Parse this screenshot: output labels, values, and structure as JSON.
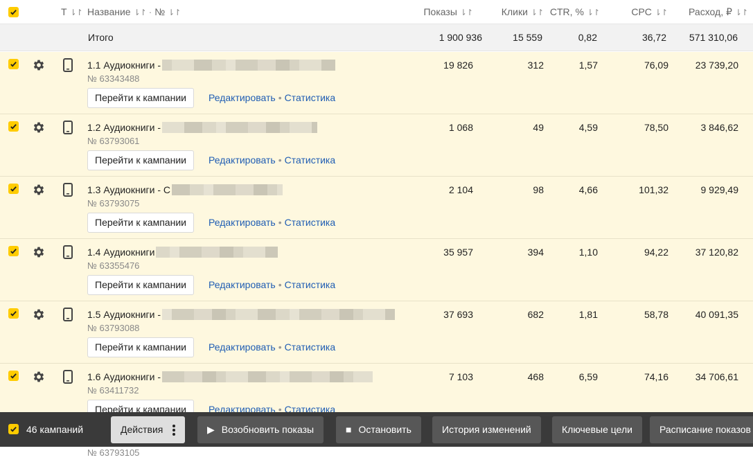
{
  "header": {
    "col_type": "Т",
    "col_name": "Название",
    "col_sep": "·",
    "col_number": "№",
    "col_shows": "Показы",
    "col_clicks": "Клики",
    "col_ctr": "CTR, %",
    "col_cpc": "CPC",
    "col_cost": "Расход, ₽",
    "sort_icon": "⇂↾"
  },
  "total": {
    "label": "Итого",
    "shows": "1 900 936",
    "clicks": "15 559",
    "ctr": "0,82",
    "cpc": "36,72",
    "cost": "571 310,06"
  },
  "row_actions": {
    "goto_label": "Перейти к кампании",
    "edit_label": "Редактировать",
    "dot": "•",
    "stats_label": "Статистика"
  },
  "rows": [
    {
      "name": "1.1 Аудиокниги -",
      "number": "№ 63343488",
      "shows": "19 826",
      "clicks": "312",
      "ctr": "1,57",
      "cpc": "76,09",
      "cost": "23 739,20"
    },
    {
      "name": "1.2 Аудиокниги -",
      "number": "№ 63793061",
      "shows": "1 068",
      "clicks": "49",
      "ctr": "4,59",
      "cpc": "78,50",
      "cost": "3 846,62"
    },
    {
      "name": "1.3 Аудиокниги - С",
      "number": "№ 63793075",
      "shows": "2 104",
      "clicks": "98",
      "ctr": "4,66",
      "cpc": "101,32",
      "cost": "9 929,49"
    },
    {
      "name": "1.4 Аудиокниги",
      "number": "№ 63355476",
      "shows": "35 957",
      "clicks": "394",
      "ctr": "1,10",
      "cpc": "94,22",
      "cost": "37 120,82"
    },
    {
      "name": "1.5 Аудиокниги -",
      "number": "№ 63793088",
      "shows": "37 693",
      "clicks": "682",
      "ctr": "1,81",
      "cpc": "58,78",
      "cost": "40 091,35"
    },
    {
      "name": "1.6 Аудиокниги -",
      "number": "№ 63411732",
      "shows": "7 103",
      "clicks": "468",
      "ctr": "6,59",
      "cpc": "74,16",
      "cost": "34 706,61"
    }
  ],
  "hidden_row": {
    "number": "№ 63793105"
  },
  "bottom_bar": {
    "count": "46 кампаний",
    "actions": "Действия",
    "resume": "Возобновить показы",
    "stop": "Остановить",
    "history": "История изменений",
    "goals": "Ключевые цели",
    "schedule": "Расписание показов"
  },
  "colors": {
    "accent": "#ffcc00",
    "row_bg": "#fef8df",
    "link": "#1f5db3",
    "bar_bg": "#3a3a3a"
  },
  "icons": [
    "check-icon",
    "gear-icon",
    "mobile-phone-icon",
    "sort-icon",
    "play-icon",
    "stop-icon",
    "kebab-icon"
  ]
}
